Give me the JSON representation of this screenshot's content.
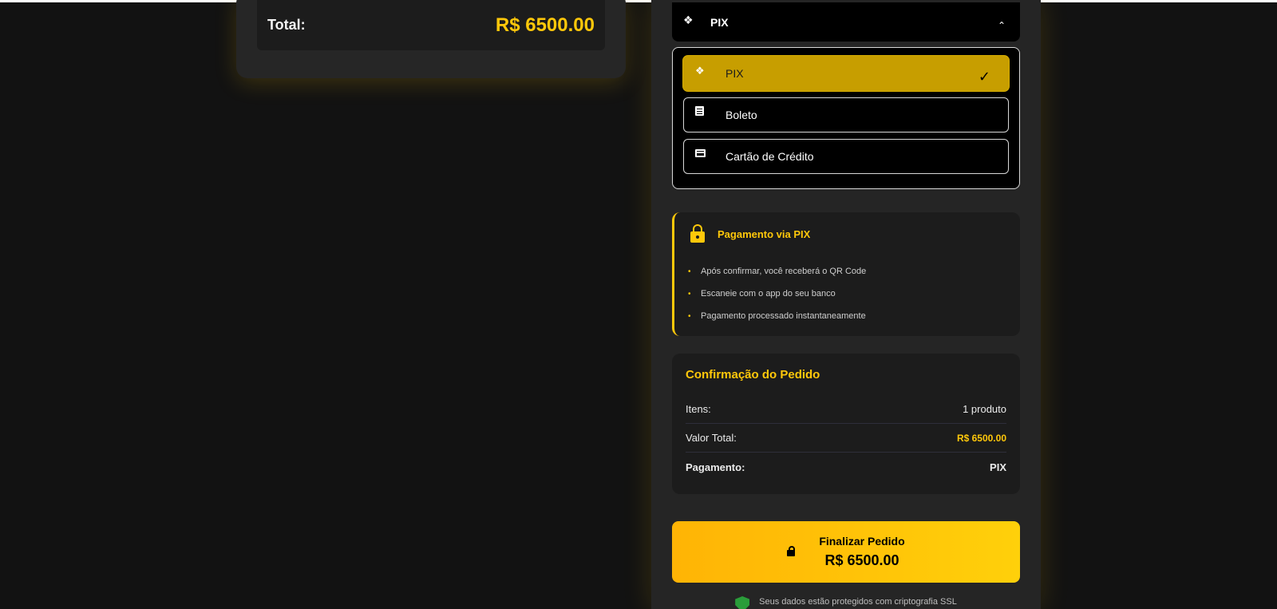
{
  "summary": {
    "total_label": "Total:",
    "total_value": "R$ 6500.00"
  },
  "payment_select": {
    "selected_label": "PIX",
    "options": [
      {
        "label": "PIX",
        "icon": "pix-diamond-icon",
        "selected": true
      },
      {
        "label": "Boleto",
        "icon": "document-icon",
        "selected": false
      },
      {
        "label": "Cartão de Crédito",
        "icon": "credit-card-icon",
        "selected": false
      }
    ],
    "check_mark": "✓"
  },
  "pix_info": {
    "title": "Pagamento via PIX",
    "items": [
      "Após confirmar, você receberá o QR Code",
      "Escaneie com o app do seu banco",
      "Pagamento processado instantaneamente"
    ]
  },
  "confirmation": {
    "title": "Confirmação do Pedido",
    "rows": [
      {
        "label": "Itens:",
        "value": "1 produto"
      },
      {
        "label": "Valor Total:",
        "value": "R$ 6500.00"
      },
      {
        "label": "Pagamento:",
        "value": "PIX"
      }
    ]
  },
  "finalize_button": {
    "label": "Finalizar Pedido",
    "amount": "R$ 6500.00"
  },
  "ssl_note": "Seus dados estão protegidos com criptografia SSL",
  "colors": {
    "accent": "#ffc80a",
    "background": "#121212",
    "panel": "#252525",
    "selected_option": "#c79e00",
    "shield": "#2a9d3a"
  }
}
